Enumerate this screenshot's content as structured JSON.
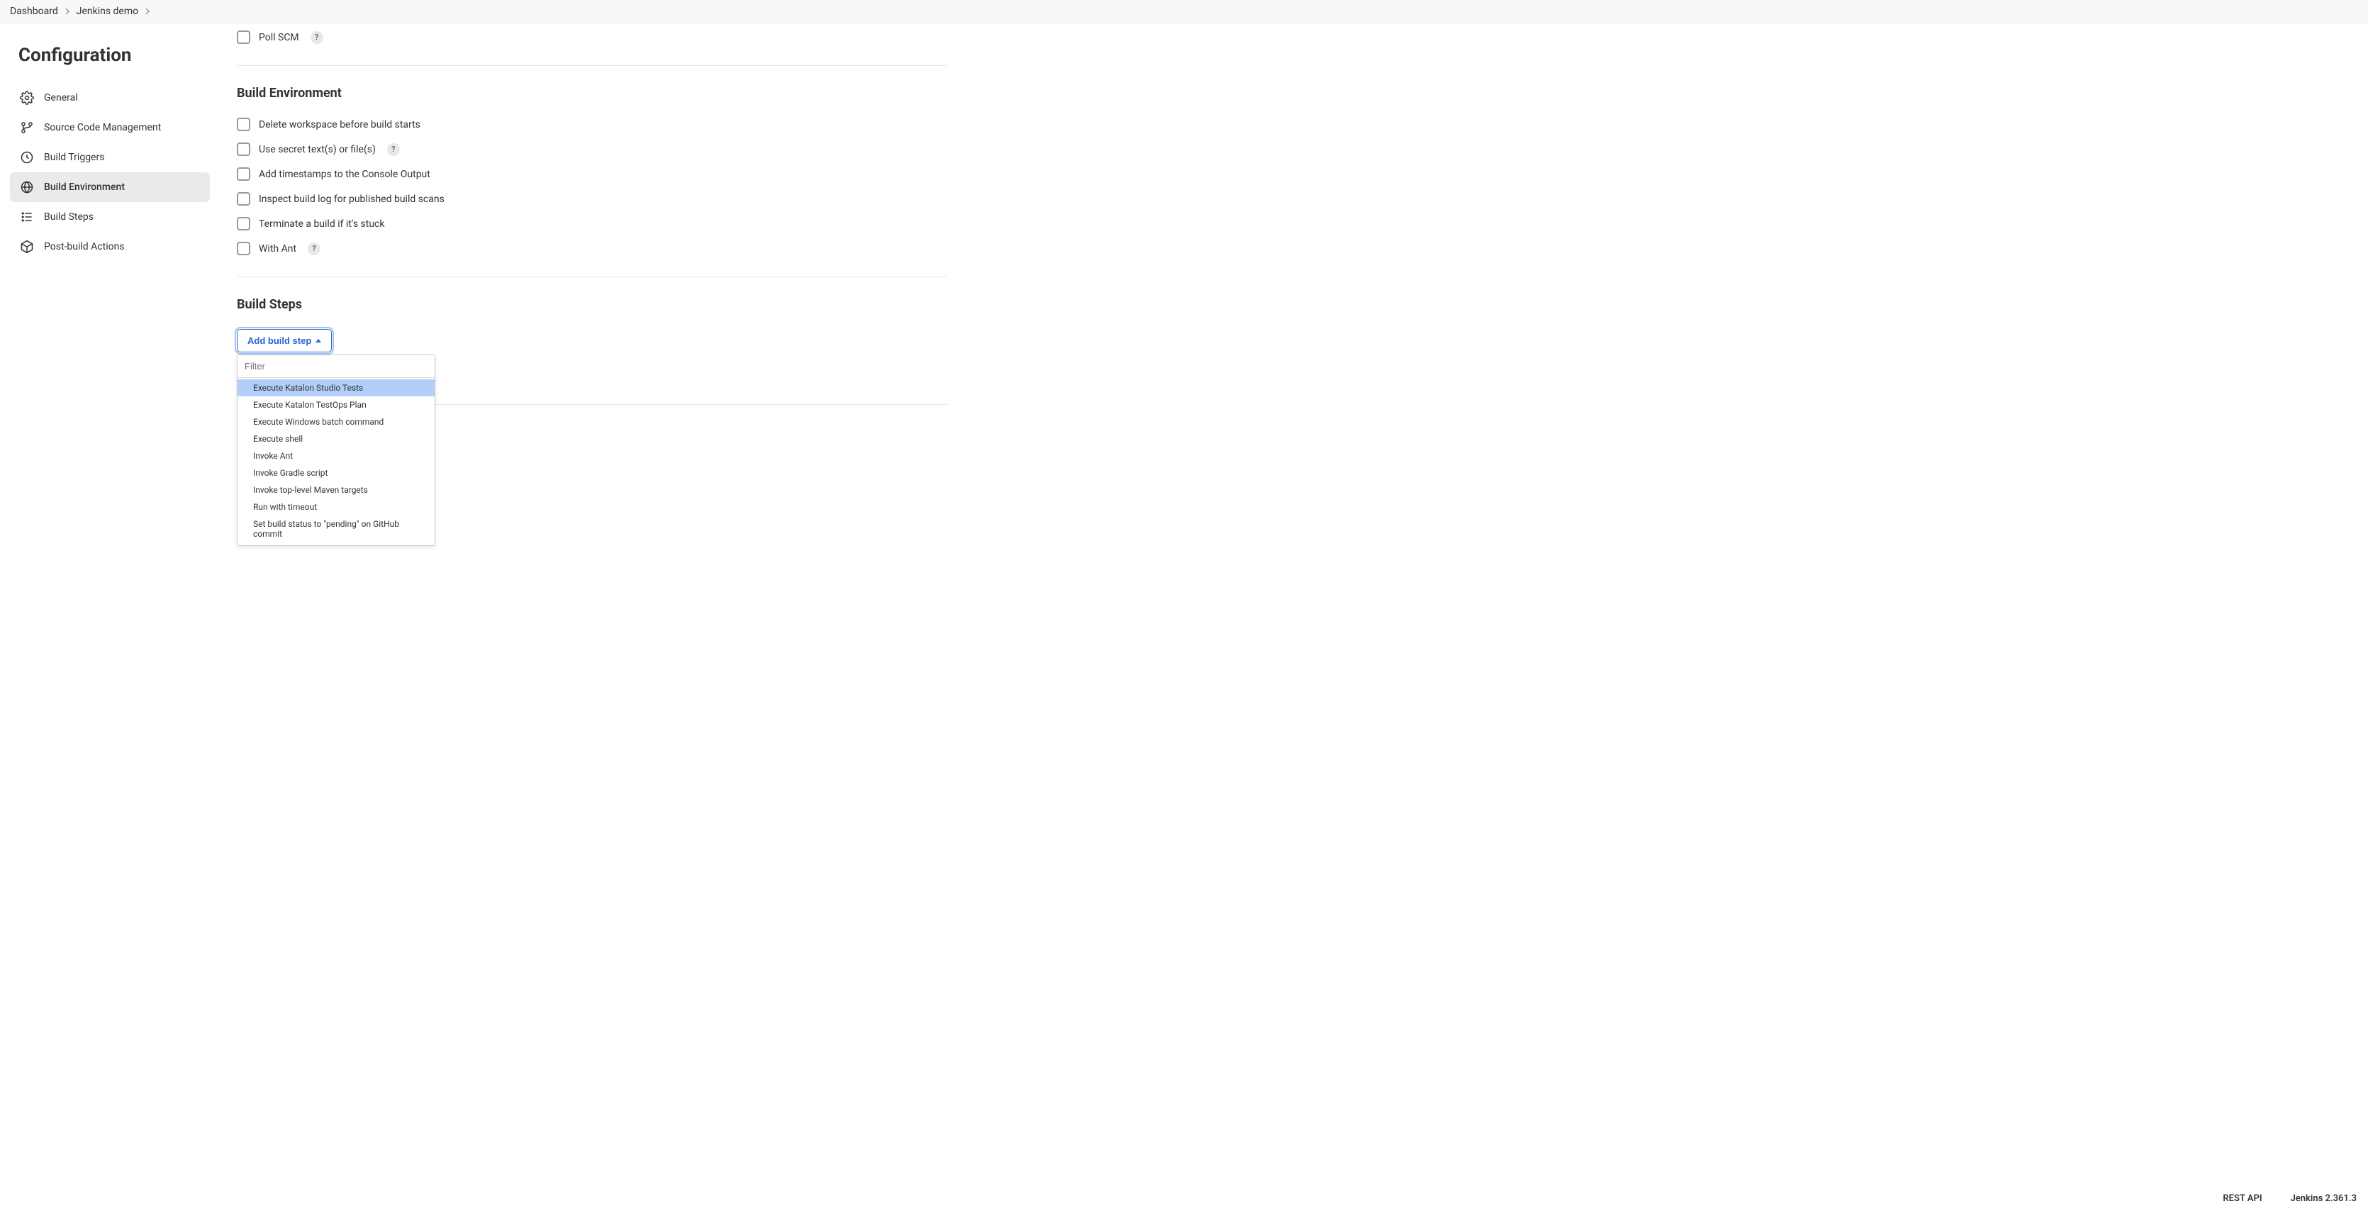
{
  "breadcrumb": {
    "items": [
      {
        "label": "Dashboard"
      },
      {
        "label": "Jenkins demo"
      }
    ]
  },
  "pageTitle": "Configuration",
  "sidebar": {
    "items": [
      {
        "label": "General"
      },
      {
        "label": "Source Code Management"
      },
      {
        "label": "Build Triggers"
      },
      {
        "label": "Build Environment"
      },
      {
        "label": "Build Steps"
      },
      {
        "label": "Post-build Actions"
      }
    ]
  },
  "triggers": {
    "pollScm": "Poll SCM"
  },
  "buildEnv": {
    "title": "Build Environment",
    "options": [
      {
        "label": "Delete workspace before build starts",
        "help": false
      },
      {
        "label": "Use secret text(s) or file(s)",
        "help": true
      },
      {
        "label": "Add timestamps to the Console Output",
        "help": false
      },
      {
        "label": "Inspect build log for published build scans",
        "help": false
      },
      {
        "label": "Terminate a build if it's stuck",
        "help": false
      },
      {
        "label": "With Ant",
        "help": true
      }
    ]
  },
  "buildSteps": {
    "title": "Build Steps",
    "addButton": "Add build step",
    "filterPlaceholder": "Filter",
    "options": [
      "Execute Katalon Studio Tests",
      "Execute Katalon TestOps Plan",
      "Execute Windows batch command",
      "Execute shell",
      "Invoke Ant",
      "Invoke Gradle script",
      "Invoke top-level Maven targets",
      "Run with timeout",
      "Set build status to \"pending\" on GitHub commit"
    ]
  },
  "footer": {
    "restApi": "REST API",
    "version": "Jenkins 2.361.3"
  },
  "helpChar": "?"
}
